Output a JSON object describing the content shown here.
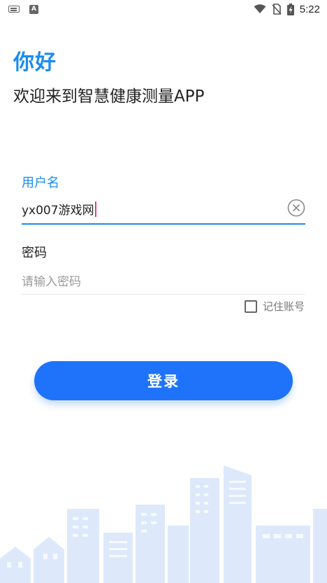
{
  "status_bar": {
    "keyboard_icon": "keyboard-icon",
    "a_icon_label": "A",
    "time": "5:22",
    "icons": [
      "wifi-icon",
      "no-sim-icon",
      "battery-charging-icon"
    ]
  },
  "greeting": {
    "hello": "你好",
    "welcome": "欢迎来到智慧健康测量APP"
  },
  "form": {
    "username_label": "用户名",
    "username_value": "yx007游戏网",
    "password_label": "密码",
    "password_placeholder": "请输入密码",
    "remember_label": "记住账号",
    "remember_checked": false,
    "login_label": "登录"
  },
  "colors": {
    "accent": "#1a8cf0",
    "button": "#1f73fa",
    "city": "#dbe8fb"
  }
}
